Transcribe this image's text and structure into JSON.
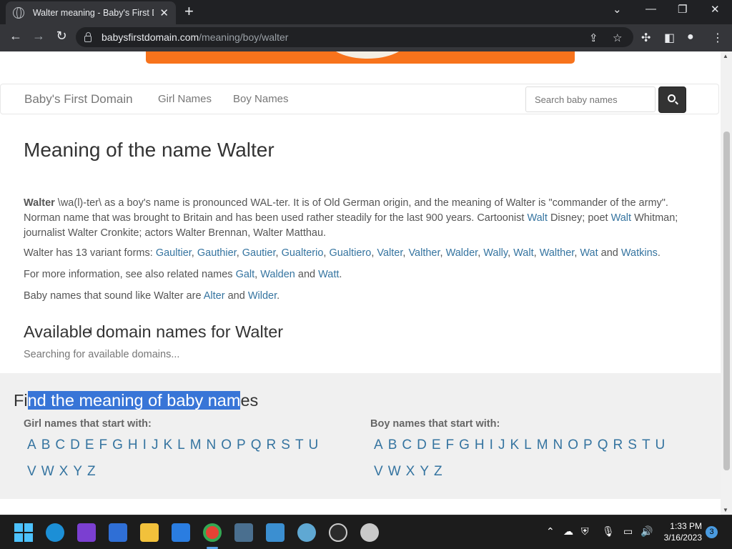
{
  "browser": {
    "tab_title": "Walter meaning - Baby's First Do",
    "url_host": "babysfirstdomain.com",
    "url_path": "/meaning/boy/walter"
  },
  "site": {
    "brand": "Baby's First Domain",
    "nav": [
      "Girl Names",
      "Boy Names"
    ],
    "search_placeholder": "Search baby names"
  },
  "article": {
    "title": "Meaning of the name Walter",
    "intro_name": "Walter",
    "intro_1": " \\wa(l)-ter\\ as a boy's name is pronounced WAL-ter. It is of Old German origin, and the meaning of Walter is \"commander of the army\". Norman name that was brought to Britain and has been used rather steadily for the last 900 years. Cartoonist ",
    "intro_link1": "Walt",
    "intro_2": " Disney; poet ",
    "intro_link2": "Walt",
    "intro_3": " Whitman; journalist Walter Cronkite; actors Walter Brennan, Walter Matthau.",
    "variants_prefix": "Walter has 13 variant forms: ",
    "variants": [
      "Gaultier",
      "Gauthier",
      "Gautier",
      "Gualterio",
      "Gualtiero",
      "Valter",
      "Valther",
      "Walder",
      "Wally",
      "Walt",
      "Walther",
      "Wat",
      "Watkins"
    ],
    "variants_and": "and",
    "related_prefix": "For more information, see also related names ",
    "related": [
      "Galt",
      "Walden",
      "Watt"
    ],
    "sound_prefix": "Baby names that sound like Walter are ",
    "sound": [
      "Alter",
      "Wilder"
    ],
    "and_word": "and",
    "available_title": "Available domain names for Walter",
    "searching": "Searching for available domains..."
  },
  "find": {
    "title_pre": "Fi",
    "title_selected": "nd the meaning of baby nam",
    "title_post": "es",
    "girl_heading": "Girl names that start with:",
    "boy_heading": "Boy names that start with:",
    "letters": [
      "A",
      "B",
      "C",
      "D",
      "E",
      "F",
      "G",
      "H",
      "I",
      "J",
      "K",
      "L",
      "M",
      "N",
      "O",
      "P",
      "Q",
      "R",
      "S",
      "T",
      "U",
      "V",
      "W",
      "X",
      "Y",
      "Z"
    ]
  },
  "taskbar": {
    "time": "1:33 PM",
    "date": "3/16/2023",
    "notifications": "3"
  }
}
